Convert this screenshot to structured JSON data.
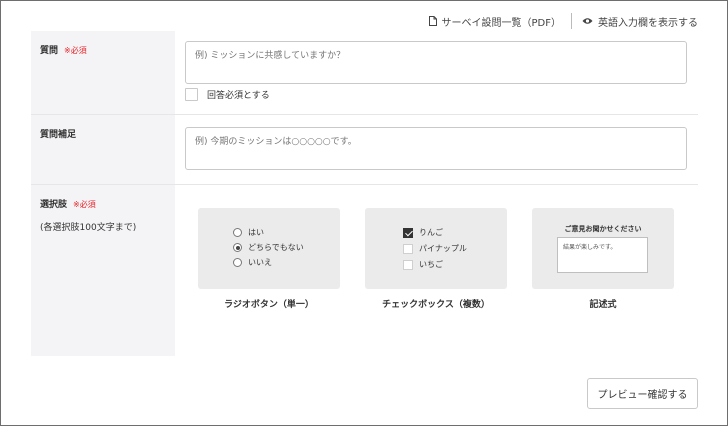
{
  "top_links": {
    "pdf_label": "サーベイ設問一覧（PDF）",
    "english_label": "英語入力欄を表示する"
  },
  "question": {
    "label": "質問",
    "required": "※必須",
    "placeholder": "例) ミッションに共感していますか？",
    "required_checkbox_label": "回答必須とする",
    "required_checked": false
  },
  "supplement": {
    "label": "質問補足",
    "placeholder": "例) 今期のミッションは○○○○○です。"
  },
  "choices": {
    "label": "選択肢",
    "required": "※必須",
    "note": "(各選択肢100文字まで)",
    "types": [
      {
        "caption": "ラジオボタン（単一）",
        "options": [
          {
            "text": "はい",
            "selected": false
          },
          {
            "text": "どちらでもない",
            "selected": true
          },
          {
            "text": "いいえ",
            "selected": false
          }
        ]
      },
      {
        "caption": "チェックボックス（複数）",
        "options": [
          {
            "text": "りんご",
            "checked": true
          },
          {
            "text": "パイナップル",
            "checked": false
          },
          {
            "text": "いちご",
            "checked": false
          }
        ]
      },
      {
        "caption": "記述式",
        "title": "ご意見お聞かせください",
        "sample": "結果が楽しみです。"
      }
    ]
  },
  "preview_button": "プレビュー確認する",
  "colors": {
    "required_red": "#e5242a",
    "label_bg": "#f4f4f6",
    "card_bg": "#ebebeb"
  },
  "icons": {
    "pdf": "document-icon",
    "english": "eye-icon"
  }
}
